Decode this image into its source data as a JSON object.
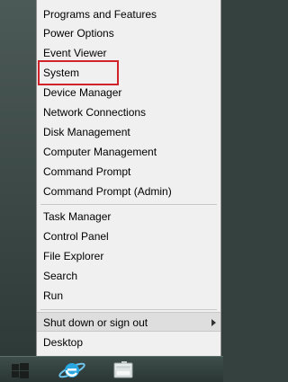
{
  "menu": {
    "items": [
      {
        "label": "Programs and Features"
      },
      {
        "label": "Power Options"
      },
      {
        "label": "Event Viewer"
      },
      {
        "label": "System"
      },
      {
        "label": "Device Manager"
      },
      {
        "label": "Network Connections"
      },
      {
        "label": "Disk Management"
      },
      {
        "label": "Computer Management"
      },
      {
        "label": "Command Prompt"
      },
      {
        "label": "Command Prompt (Admin)"
      },
      {
        "label": "Task Manager"
      },
      {
        "label": "Control Panel"
      },
      {
        "label": "File Explorer"
      },
      {
        "label": "Search"
      },
      {
        "label": "Run"
      },
      {
        "label": "Shut down or sign out"
      },
      {
        "label": "Desktop"
      }
    ]
  },
  "highlight_color": "#d2232a",
  "taskbar": {
    "icons": [
      "windows-start-icon",
      "internet-explorer-icon",
      "file-explorer-icon"
    ]
  }
}
